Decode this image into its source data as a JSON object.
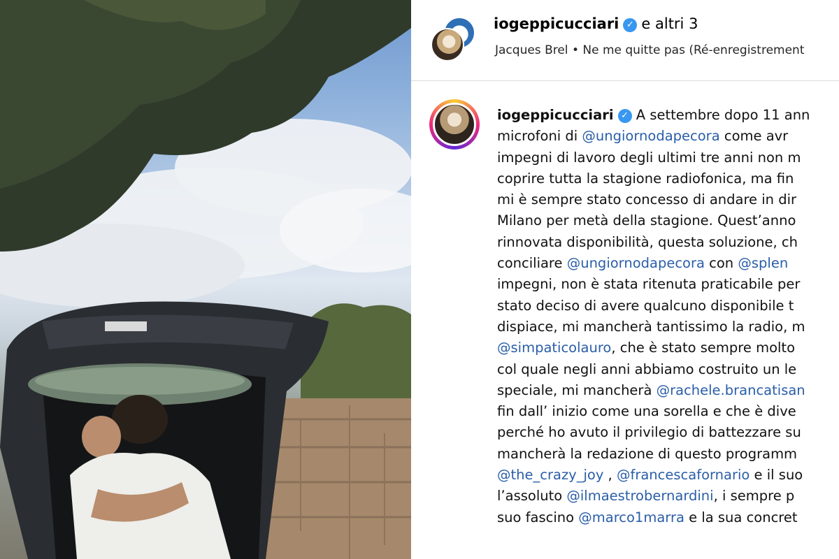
{
  "header": {
    "username": "iogeppicucciari",
    "verified_symbol": "✓",
    "collaborators": "e altri 3",
    "audio": {
      "artist": "Jacques Brel",
      "separator": "•",
      "track": "Ne me quitte pas (Ré-enregistrement"
    }
  },
  "caption": {
    "username": "iogeppicucciari",
    "verified_symbol": "✓",
    "lines": [
      [
        {
          "t": "A settembre dopo 11 ann",
          "m": false
        }
      ],
      [
        {
          "t": "microfoni di ",
          "m": false
        },
        {
          "t": "@ungiornodapecora",
          "m": true
        },
        {
          "t": " come avr",
          "m": false
        }
      ],
      [
        {
          "t": "impegni di lavoro degli ultimi tre anni non m",
          "m": false
        }
      ],
      [
        {
          "t": "coprire tutta la stagione radiofonica, ma fin",
          "m": false
        }
      ],
      [
        {
          "t": "mi è sempre stato concesso di andare in dir",
          "m": false
        }
      ],
      [
        {
          "t": "Milano per metà della stagione. Quest’anno",
          "m": false
        }
      ],
      [
        {
          "t": "rinnovata disponibilità, questa soluzione, ch",
          "m": false
        }
      ],
      [
        {
          "t": "conciliare ",
          "m": false
        },
        {
          "t": "@ungiornodapecora",
          "m": true
        },
        {
          "t": " con ",
          "m": false
        },
        {
          "t": "@splen",
          "m": true
        }
      ],
      [
        {
          "t": "impegni, non è stata ritenuta praticabile per",
          "m": false
        }
      ],
      [
        {
          "t": "stato deciso di avere qualcuno disponibile t",
          "m": false
        }
      ],
      [
        {
          "t": "dispiace, mi mancherà tantissimo la radio, m",
          "m": false
        }
      ],
      [
        {
          "t": "@simpaticolauro",
          "m": true
        },
        {
          "t": ", che è stato sempre molto",
          "m": false
        }
      ],
      [
        {
          "t": "col quale negli anni abbiamo costruito un le",
          "m": false
        }
      ],
      [
        {
          "t": "speciale, mi mancherà ",
          "m": false
        },
        {
          "t": "@rachele.brancatisan",
          "m": true
        }
      ],
      [
        {
          "t": "fin dall’ inizio come una sorella e che è dive",
          "m": false
        }
      ],
      [
        {
          "t": "perché ho avuto il privilegio di battezzare su",
          "m": false
        }
      ],
      [
        {
          "t": "mancherà la redazione di questo programm",
          "m": false
        }
      ],
      [
        {
          "t": "@the_crazy_joy",
          "m": true
        },
        {
          "t": " , ",
          "m": false
        },
        {
          "t": "@francescafornario",
          "m": true
        },
        {
          "t": " e il suo",
          "m": false
        }
      ],
      [
        {
          "t": "l’assoluto ",
          "m": false
        },
        {
          "t": "@ilmaestrobernardini",
          "m": true
        },
        {
          "t": ", i sempre p",
          "m": false
        }
      ],
      [
        {
          "t": "suo fascino ",
          "m": false
        },
        {
          "t": "@marco1marra",
          "m": true
        },
        {
          "t": " e la sua concret",
          "m": false
        }
      ]
    ]
  },
  "colors": {
    "mention": "#00376b",
    "verified": "#3897f0",
    "divider": "#dbdbdb"
  }
}
